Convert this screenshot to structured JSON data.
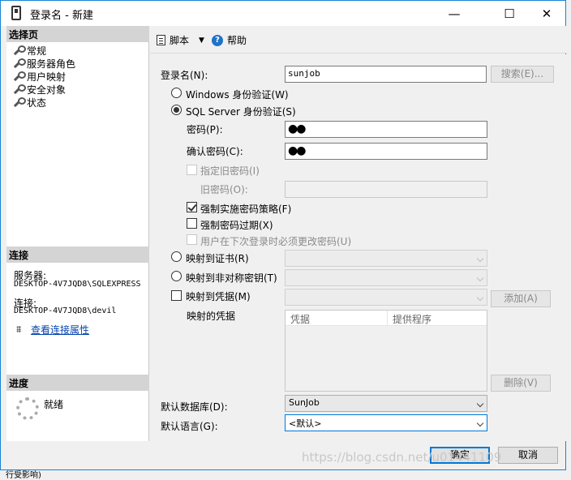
{
  "window": {
    "title": "登录名 - 新建",
    "minimize": "—",
    "maximize": "☐",
    "close": "✕"
  },
  "left": {
    "select_page_header": "选择页",
    "pages": [
      "常规",
      "服务器角色",
      "用户映射",
      "安全对象",
      "状态"
    ],
    "connection_header": "连接",
    "server_label": "服务器:",
    "server_value": "DESKTOP-4V7JQD8\\SQLEXPRESS",
    "conn_label": "连接:",
    "conn_value": "DESKTOP-4V7JQD8\\devil",
    "view_conn_props": "查看连接属性",
    "progress_header": "进度",
    "progress_status": "就绪"
  },
  "toolbar": {
    "script_label": "脚本",
    "help_label": "帮助"
  },
  "form": {
    "login_name_label": "登录名(N):",
    "login_name_value": "sunjob",
    "search_button": "搜索(E)...",
    "windows_auth": "Windows 身份验证(W)",
    "sql_auth": "SQL Server 身份验证(S)",
    "password_label": "密码(P):",
    "password_value": "●●",
    "confirm_password_label": "确认密码(C):",
    "confirm_password_value": "●●",
    "specify_old_password": "指定旧密码(I)",
    "old_password_label": "旧密码(O):",
    "enforce_policy": "强制实施密码策略(F)",
    "enforce_expiration": "强制密码过期(X)",
    "must_change": "用户在下次登录时必须更改密码(U)",
    "map_to_certificate": "映射到证书(R)",
    "map_to_asym_key": "映射到非对称密钥(T)",
    "map_to_credential": "映射到凭据(M)",
    "add_button": "添加(A)",
    "mapped_credentials_label": "映射的凭据",
    "grid_col_credential": "凭据",
    "grid_col_provider": "提供程序",
    "remove_button": "删除(V)",
    "default_database_label": "默认数据库(D):",
    "default_database_value": "SunJob",
    "default_language_label": "默认语言(G):",
    "default_language_value": "<默认>"
  },
  "footer": {
    "ok_button": "确定",
    "cancel_button": "取消"
  },
  "watermark": "https://blog.csdn.net/u01441109",
  "background_text": "行受影响)"
}
